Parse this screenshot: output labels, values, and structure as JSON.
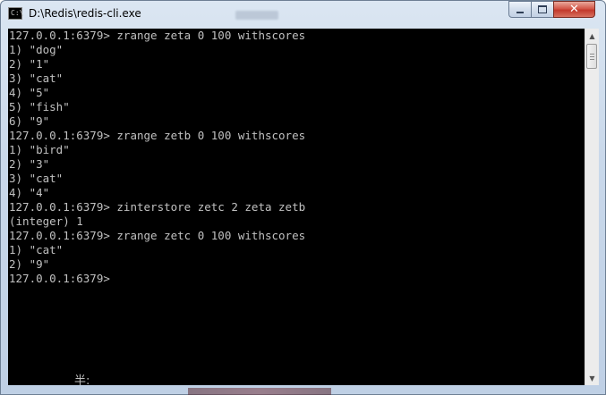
{
  "window": {
    "title": "D:\\Redis\\redis-cli.exe",
    "app_icon_glyph": "C:\\",
    "controls": {
      "minimize": "minimize-icon",
      "maximize": "maximize-icon",
      "close": "close-icon",
      "close_glyph": "✕"
    }
  },
  "console": {
    "background": "#000000",
    "foreground": "#c0c0c0",
    "lines": [
      "127.0.0.1:6379> zrange zeta 0 100 withscores",
      "1) \"dog\"",
      "2) \"1\"",
      "3) \"cat\"",
      "4) \"5\"",
      "5) \"fish\"",
      "6) \"9\"",
      "127.0.0.1:6379> zrange zetb 0 100 withscores",
      "1) \"bird\"",
      "2) \"3\"",
      "3) \"cat\"",
      "4) \"4\"",
      "127.0.0.1:6379> zinterstore zetc 2 zeta zetb",
      "(integer) 1",
      "127.0.0.1:6379> zrange zetc 0 100 withscores",
      "1) \"cat\"",
      "2) \"9\"",
      "127.0.0.1:6379>"
    ],
    "ime_indicator": "半:"
  },
  "scrollbar": {
    "up_arrow": "▲",
    "down_arrow": "▼"
  }
}
